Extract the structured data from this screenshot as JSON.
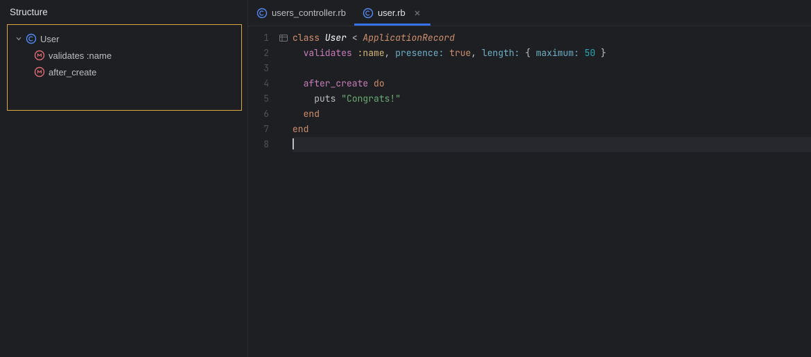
{
  "sidebar": {
    "title": "Structure",
    "tree": {
      "root": {
        "label": "User",
        "icon": "class-icon"
      },
      "children": [
        {
          "label": "validates :name",
          "icon": "method-icon"
        },
        {
          "label": "after_create",
          "icon": "method-icon"
        }
      ]
    }
  },
  "tabs": [
    {
      "label": "users_controller.rb",
      "icon": "class-icon",
      "active": false,
      "closable": false
    },
    {
      "label": "user.rb",
      "icon": "class-icon",
      "active": true,
      "closable": true
    }
  ],
  "editor": {
    "line_numbers": [
      "1",
      "2",
      "3",
      "4",
      "5",
      "6",
      "7",
      "8"
    ],
    "code": {
      "l1": {
        "kw1": "class ",
        "cls": "User",
        "punct1": " < ",
        "const": "ApplicationRecord"
      },
      "l2": {
        "indent": "  ",
        "method": "validates ",
        "sym": ":name",
        "punct1": ", ",
        "key1": "presence: ",
        "bool": "true",
        "punct2": ", ",
        "key2": "length: ",
        "punct3": "{ ",
        "key3": "maximum: ",
        "num": "50",
        "punct4": " }"
      },
      "l3": "",
      "l4": {
        "indent": "  ",
        "method": "after_create ",
        "do": "do"
      },
      "l5": {
        "indent": "    ",
        "ident": "puts ",
        "str": "\"Congrats!\""
      },
      "l6": {
        "indent": "  ",
        "end": "end"
      },
      "l7": {
        "end": "end"
      },
      "l8": ""
    }
  }
}
